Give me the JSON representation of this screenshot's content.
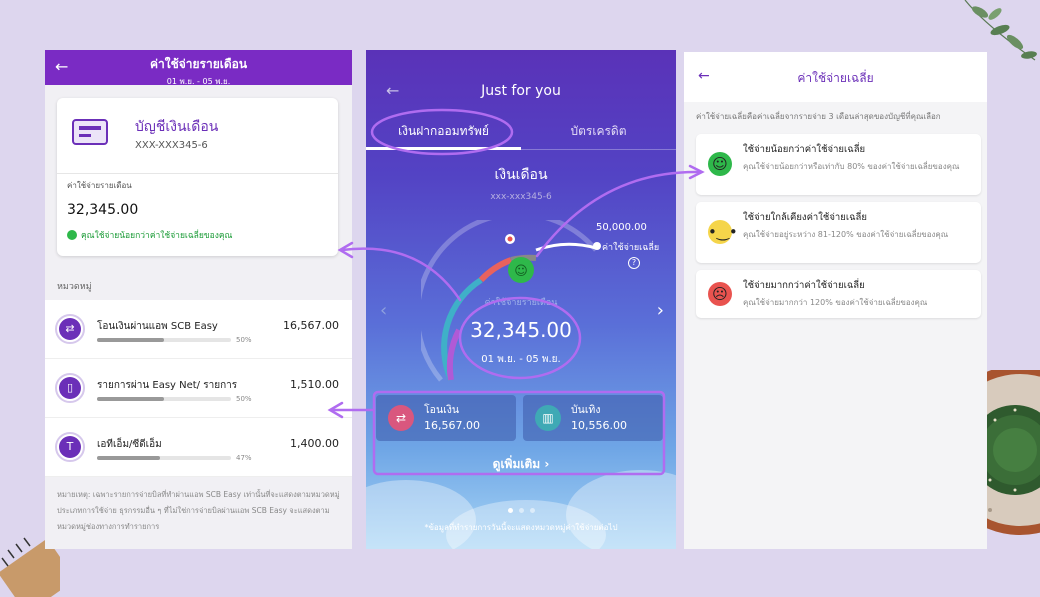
{
  "left": {
    "header": {
      "title": "ค่าใช้จ่ายรายเดือน",
      "subtitle": "01 พ.ย. - 05 พ.ย."
    },
    "account": {
      "name": "บัญชีเงินเดือน",
      "number": "XXX-XXX345-6"
    },
    "expense": {
      "label": "ค่าใช้จ่ายรายเดือน",
      "amount": "32,345.00",
      "note": "คุณใช้จ่ายน้อยกว่าค่าใช้จ่ายเฉลี่ยของคุณ"
    },
    "category_title": "หมวดหมู่",
    "categories": [
      {
        "name": "โอนเงินผ่านแอพ SCB Easy",
        "amount": "16,567.00",
        "percent": "50%",
        "fill": 0.5,
        "icon": "shuffle-icon"
      },
      {
        "name": "รายการผ่าน Easy Net/ รายการอื่น ๆ ผ่...",
        "amount": "1,510.00",
        "percent": "50%",
        "fill": 0.5,
        "icon": "phone-icon"
      },
      {
        "name": "เอทีเอ็ม/ซีดีเอ็ม",
        "amount": "1,400.00",
        "percent": "47%",
        "fill": 0.47,
        "icon": "atm-icon"
      }
    ],
    "footnote": "หมายเหตุ: เฉพาะรายการจ่ายบิลที่ทำผ่านแอพ SCB Easy เท่านั้นที่จะแสดงตามหมวดหมู่ประเภทการใช้จ่าย ธุรกรรมอื่น ๆ ที่ไม่ใช่การจ่ายบิลผ่านแอพ SCB Easy จะแสดงตามหมวดหมู่ช่องทางการทำรายการ"
  },
  "middle": {
    "title": "Just for you",
    "tabs": [
      {
        "label": "เงินฝากออมทรัพย์",
        "active": true
      },
      {
        "label": "บัตรเครดิต",
        "active": false
      }
    ],
    "account_name": "เงินเดือน",
    "account_number": "xxx-xxx345-6",
    "budget_amount": "50,000.00",
    "budget_label": "ค่าใช้จ่ายเฉลี่ย",
    "gauge_label": "ค่าใช้จ่ายรายเดือน",
    "gauge_amount": "32,345.00",
    "gauge_date": "01 พ.ย. - 05 พ.ย.",
    "cards": [
      {
        "name": "โอนเงิน",
        "value": "16,567.00",
        "icon": "shuffle-icon",
        "color": "#d9577e"
      },
      {
        "name": "บันเทิง",
        "value": "10,556.00",
        "icon": "popcorn-icon",
        "color": "#3fa9b5"
      }
    ],
    "see_more": "ดูเพิ่มเติม",
    "footnote": "*ข้อมูลที่ทำรายการวันนี้จะแสดงหมวดหมู่ค่าใช้จ่ายต่อไป"
  },
  "right": {
    "header_title": "ค่าใช้จ่ายเฉลี่ย",
    "description": "ค่าใช้จ่ายเฉลี่ยคือค่าเฉลี่ยจากรายจ่าย 3 เดือนล่าสุดของบัญชีที่คุณเลือก",
    "items": [
      {
        "title": "ใช้จ่ายน้อยกว่าค่าใช้จ่ายเฉลี่ย",
        "desc": "คุณใช้จ่ายน้อยกว่าหรือเท่ากับ 80% ของค่าใช้จ่ายเฉลี่ยของคุณ",
        "color": "#2eb84a",
        "icon": "happy-face-icon"
      },
      {
        "title": "ใช้จ่ายใกล้เคียงค่าใช้จ่ายเฉลี่ย",
        "desc": "คุณใช้จ่ายอยู่ระหว่าง 81-120% ของค่าใช้จ่ายเฉลี่ยของคุณ",
        "color": "#f5d54a",
        "icon": "neutral-face-icon"
      },
      {
        "title": "ใช้จ่ายมากกว่าค่าใช้จ่ายเฉลี่ย",
        "desc": "คุณใช้จ่ายมากกว่า 120% ของค่าใช้จ่ายเฉลี่ยของคุณ",
        "color": "#e9534f",
        "icon": "sad-face-icon"
      }
    ]
  },
  "colors": {
    "brand_purple": "#7a2bc4",
    "annotation": "#b06cf0"
  }
}
